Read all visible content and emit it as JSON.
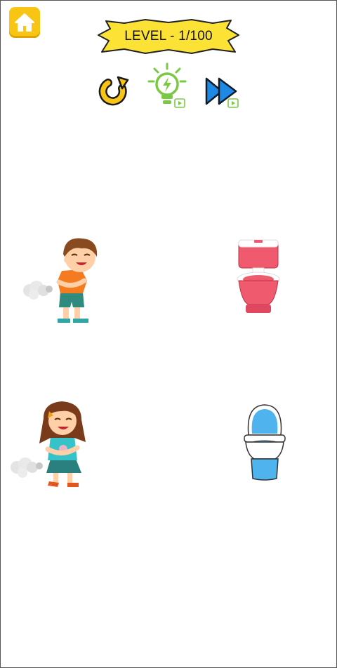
{
  "header": {
    "level_label": "LEVEL - 1/100"
  },
  "icons": {
    "home": "home-icon",
    "restart": "restart-icon",
    "hint": "lightbulb-hint-icon",
    "skip": "fast-forward-skip-icon",
    "video": "video-ad-icon"
  },
  "colors": {
    "home_button": "#f9c515",
    "banner": "#fbe234",
    "hint_green": "#7ac943",
    "skip_blue": "#1e88e5",
    "boy_shirt": "#f47b20",
    "girl_shirt": "#36c2c9",
    "toilet_pink": "#ef5a6f",
    "toilet_blue": "#4fb3ee"
  }
}
